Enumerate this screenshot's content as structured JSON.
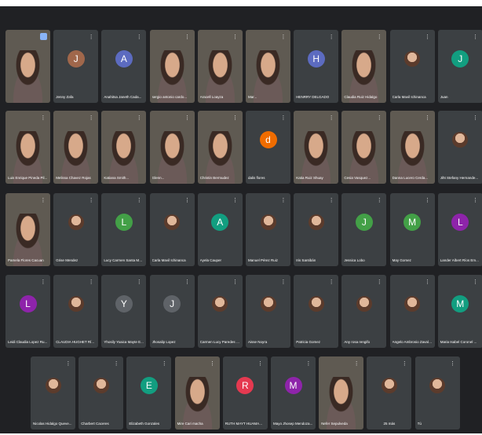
{
  "tiles": [
    {
      "name": "",
      "type": "video",
      "self": true
    },
    {
      "name": "Jenny Zafa",
      "avatar": "J",
      "color": "#a0674b"
    },
    {
      "name": "Anahitsa Janeth Cada...",
      "avatar": "A",
      "color": "#5c6bc0"
    },
    {
      "name": "sergio antonio cardo...",
      "type": "video"
    },
    {
      "name": "Aracell Loayza",
      "type": "video"
    },
    {
      "name": "Mar...",
      "type": "video"
    },
    {
      "name": "HENRRY DELGADO",
      "avatar": "H",
      "color": "#5c6bc0"
    },
    {
      "name": "Claudia Ruiz Hidalgo",
      "type": "video"
    },
    {
      "name": "Carla Mavil Ichinanca",
      "type": "photo"
    },
    {
      "name": "Juan",
      "avatar": "J",
      "color": "#129e80"
    },
    {
      "name": "Luis Enrique Pineda Pil...",
      "type": "video"
    },
    {
      "name": "Melissa Chavez Rojas",
      "type": "video"
    },
    {
      "name": "Katiana Smith...",
      "type": "video"
    },
    {
      "name": "Glenn...",
      "type": "video"
    },
    {
      "name": "Christin Bermudez",
      "type": "video"
    },
    {
      "name": "dalis flores",
      "avatar": "d",
      "color": "#ef6c00"
    },
    {
      "name": "Katia Ruiz Shuay",
      "type": "video"
    },
    {
      "name": "Cesia Vasquez...",
      "type": "video"
    },
    {
      "name": "Danna Lucero Cerda...",
      "type": "video"
    },
    {
      "name": "Jiht Stefany Hernande...",
      "type": "photo"
    },
    {
      "name": "Pamela Flores Cacuan",
      "type": "video"
    },
    {
      "name": "Grise Mendez",
      "type": "photo"
    },
    {
      "name": "Lucy Carmen Santa Mar...",
      "avatar": "L",
      "color": "#43a047"
    },
    {
      "name": "Carla Mavil Ichinanca",
      "type": "photo"
    },
    {
      "name": "Ayela Cauper",
      "avatar": "A",
      "color": "#129e80"
    },
    {
      "name": "Manuel Pérez Ruiz",
      "type": "photo"
    },
    {
      "name": "Iris Santibán",
      "type": "photo"
    },
    {
      "name": "Jessica Lobo",
      "avatar": "J",
      "color": "#43a047"
    },
    {
      "name": "May Gomez",
      "avatar": "M",
      "color": "#43a047"
    },
    {
      "name": "Lander Albert Ríos Em...",
      "avatar": "L",
      "color": "#8e24aa"
    },
    {
      "name": "Leidi Claudia Lopez Ru...",
      "avatar": "L",
      "color": "#8e24aa"
    },
    {
      "name": "CLAUDIA HUGHET RÍ...",
      "type": "photo"
    },
    {
      "name": "Yhosily Yoaica Mayte E...",
      "avatar": "Y",
      "color": "#5f6368"
    },
    {
      "name": "Jhosalip Lopez",
      "avatar": "J",
      "color": "#5f6368"
    },
    {
      "name": "Carmen Lucy Paredes T...",
      "type": "photo"
    },
    {
      "name": "Aisse Noyra",
      "type": "photo"
    },
    {
      "name": "Patricia Gomez",
      "type": "photo"
    },
    {
      "name": "Any rosa rengifo",
      "type": "photo"
    },
    {
      "name": "Angelo Ambrosio Zavala...",
      "type": "photo"
    },
    {
      "name": "Maria Isabel Coronel ...",
      "avatar": "M",
      "color": "#129e80"
    },
    {
      "name": "Nicolas Hidalgo Queve...",
      "type": "photo"
    },
    {
      "name": "Charbert Caceres",
      "type": "photo"
    },
    {
      "name": "Elizabeth Gonzales",
      "avatar": "E",
      "color": "#129e80"
    },
    {
      "name": "Mire Cari macha",
      "type": "video"
    },
    {
      "name": "RUTH MAYT HUAMAN S...",
      "avatar": "R",
      "color": "#e53950"
    },
    {
      "name": "Mayo Jhosep Mendoza...",
      "avatar": "M",
      "color": "#8e24aa"
    },
    {
      "name": "Nefer Sepulveda",
      "type": "video"
    },
    {
      "name": "25 más",
      "type": "more"
    },
    {
      "name": "Tú",
      "type": "photo"
    }
  ]
}
